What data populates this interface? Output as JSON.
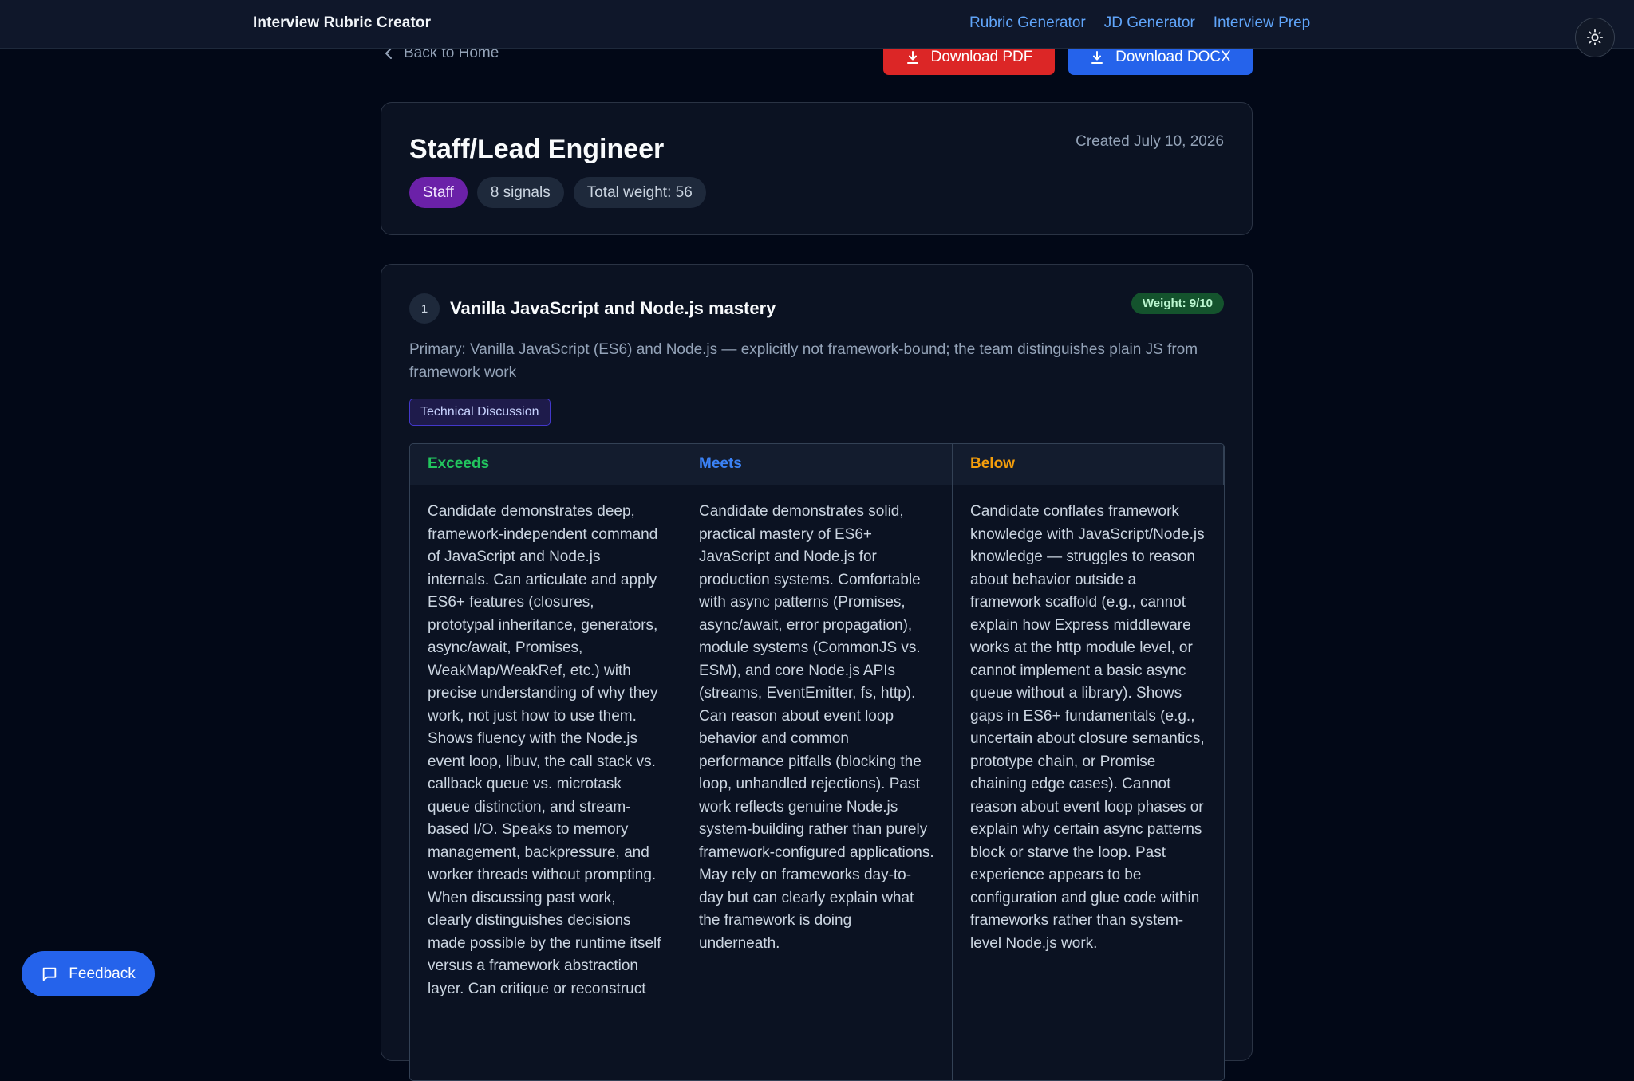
{
  "nav": {
    "brand": "Interview Rubric Creator",
    "links": [
      "Rubric Generator",
      "JD Generator",
      "Interview Prep"
    ],
    "theme_icon": "sun-icon"
  },
  "actions": {
    "back_label": "Back to Home",
    "download_pdf_label": "Download PDF",
    "download_docx_label": "Download DOCX",
    "colors": {
      "pdf": "#dc2626",
      "docx": "#2563eb"
    }
  },
  "rubric": {
    "title": "Staff/Lead Engineer",
    "created": "Created July 10, 2026",
    "level_badge": "Staff",
    "signals_badge": "8 signals",
    "weight_badge": "Total weight: 56"
  },
  "signal": {
    "number": "1",
    "title": "Vanilla JavaScript and Node.js mastery",
    "weight": "Weight: 9/10",
    "description": "Primary: Vanilla JavaScript (ES6) and Node.js — explicitly not framework-bound; the team distinguishes plain JS from framework work",
    "type_tag": "Technical Discussion",
    "columns": {
      "exceeds": {
        "label": "Exceeds",
        "text": "Candidate demonstrates deep, framework-independent command of JavaScript and Node.js internals. Can articulate and apply ES6+ features (closures, prototypal inheritance, generators, async/await, Promises, WeakMap/WeakRef, etc.) with precise understanding of why they work, not just how to use them. Shows fluency with the Node.js event loop, libuv, the call stack vs. callback queue vs. microtask queue distinction, and stream-based I/O. Speaks to memory management, backpressure, and worker threads without prompting. When discussing past work, clearly distinguishes decisions made possible by the runtime itself versus a framework abstraction layer. Can critique or reconstruct"
      },
      "meets": {
        "label": "Meets",
        "text": "Candidate demonstrates solid, practical mastery of ES6+ JavaScript and Node.js for production systems. Comfortable with async patterns (Promises, async/await, error propagation), module systems (CommonJS vs. ESM), and core Node.js APIs (streams, EventEmitter, fs, http). Can reason about event loop behavior and common performance pitfalls (blocking the loop, unhandled rejections). Past work reflects genuine Node.js system-building rather than purely framework-configured applications. May rely on frameworks day-to-day but can clearly explain what the framework is doing underneath."
      },
      "below": {
        "label": "Below",
        "text": "Candidate conflates framework knowledge with JavaScript/Node.js knowledge — struggles to reason about behavior outside a framework scaffold (e.g., cannot explain how Express middleware works at the http module level, or cannot implement a basic async queue without a library). Shows gaps in ES6+ fundamentals (e.g., uncertain about closure semantics, prototype chain, or Promise chaining edge cases). Cannot reason about event loop phases or explain why certain async patterns block or starve the loop. Past experience appears to be configuration and glue code within frameworks rather than system-level Node.js work."
      }
    }
  },
  "feedback": {
    "label": "Feedback",
    "icon": "chat-bubble-icon"
  }
}
